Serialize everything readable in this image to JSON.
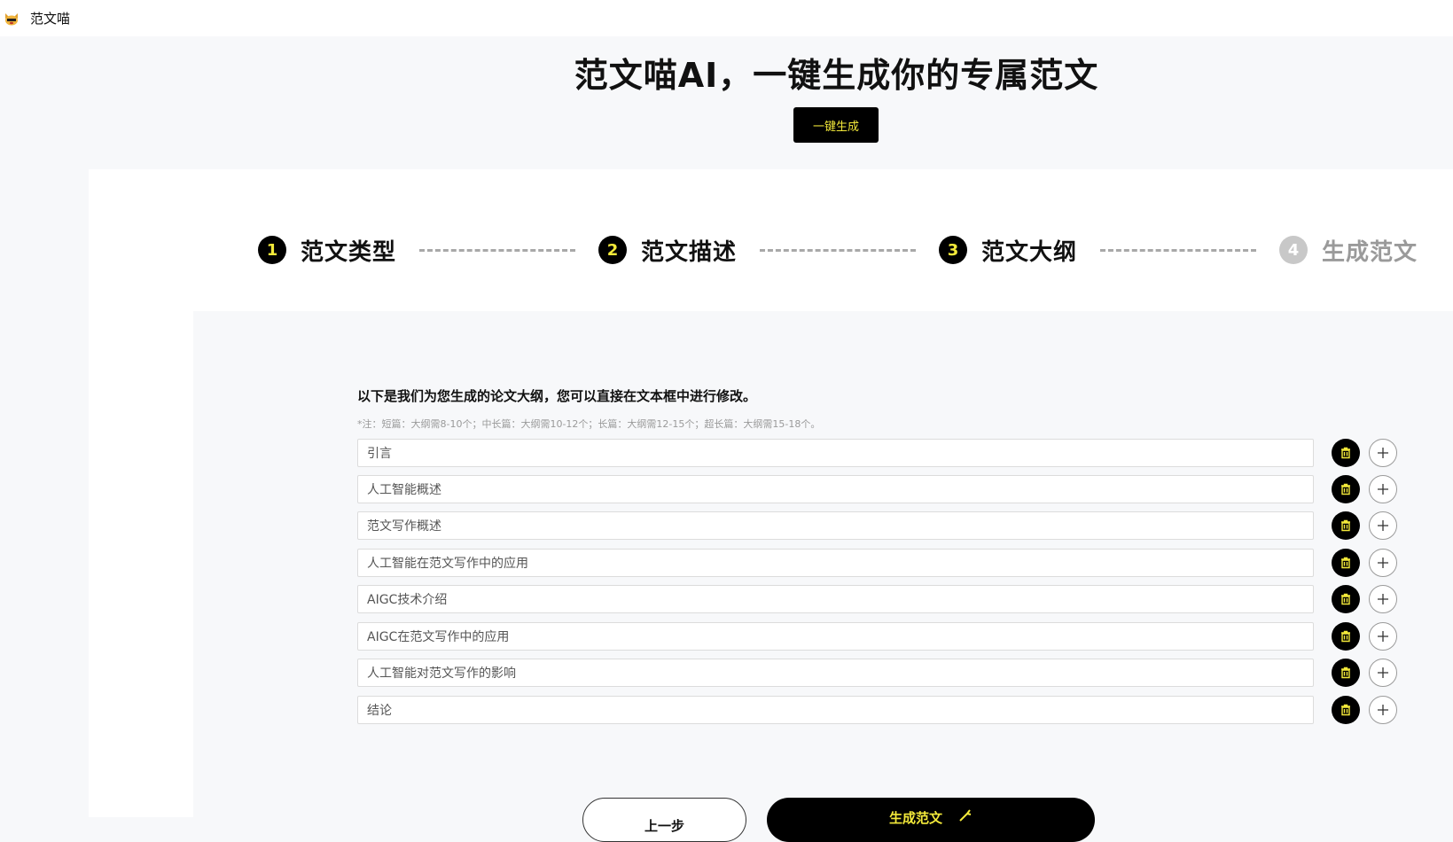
{
  "app": {
    "name": "范文喵"
  },
  "hero": {
    "title": "范文喵AI，一键生成你的专属范文",
    "button": "一键生成"
  },
  "steps": [
    {
      "num": "1",
      "label": "范文类型",
      "state": "done"
    },
    {
      "num": "2",
      "label": "范文描述",
      "state": "done"
    },
    {
      "num": "3",
      "label": "范文大纲",
      "state": "active"
    },
    {
      "num": "4",
      "label": "生成范文",
      "state": "inactive"
    }
  ],
  "outline": {
    "instruction": "以下是我们为您生成的论文大纲，您可以直接在文本框中进行修改。",
    "note": "*注：短篇：大纲需8-10个；中长篇：大纲需10-12个；长篇：大纲需12-15个；超长篇：大纲需15-18个。",
    "items": [
      "引言",
      "人工智能概述",
      "范文写作概述",
      "人工智能在范文写作中的应用",
      "AIGC技术介绍",
      "AIGC在范文写作中的应用",
      "人工智能对范文写作的影响",
      "结论"
    ]
  },
  "actions": {
    "prev": "上一步",
    "generate": "生成范文"
  },
  "colors": {
    "accent": "#f3e93a",
    "primary": "#000000",
    "panel_bg": "#f7f8fa"
  },
  "icons": {
    "delete": "trash-icon",
    "add": "plus-icon",
    "logo": "cat-logo-icon"
  }
}
